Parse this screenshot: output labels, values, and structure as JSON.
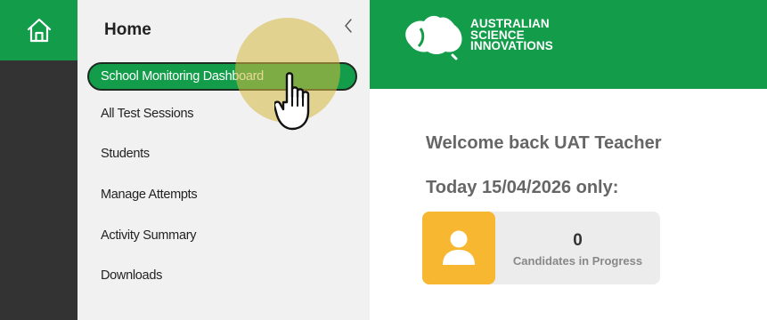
{
  "rail": {
    "home_icon": "home-icon"
  },
  "menu": {
    "title": "Home",
    "collapse_icon": "chevron-left-icon",
    "items": [
      {
        "label": "School Monitoring Dashboard",
        "active": true
      },
      {
        "label": "All Test Sessions"
      },
      {
        "label": "Students"
      },
      {
        "label": "Manage Attempts"
      },
      {
        "label": "Activity Summary"
      },
      {
        "label": "Downloads"
      }
    ]
  },
  "header": {
    "logo_lines": [
      "AUSTRALIAN",
      "SCIENCE",
      "INNOVATIONS"
    ]
  },
  "main": {
    "welcome": "Welcome back UAT Teacher",
    "today": "Today 15/04/2026 only:",
    "stat": {
      "value": "0",
      "label": "Candidates in Progress",
      "icon": "user-icon"
    }
  },
  "colors": {
    "brand_green": "#139d4a",
    "rail_dark": "#333333",
    "stat_accent": "#f7b731"
  }
}
